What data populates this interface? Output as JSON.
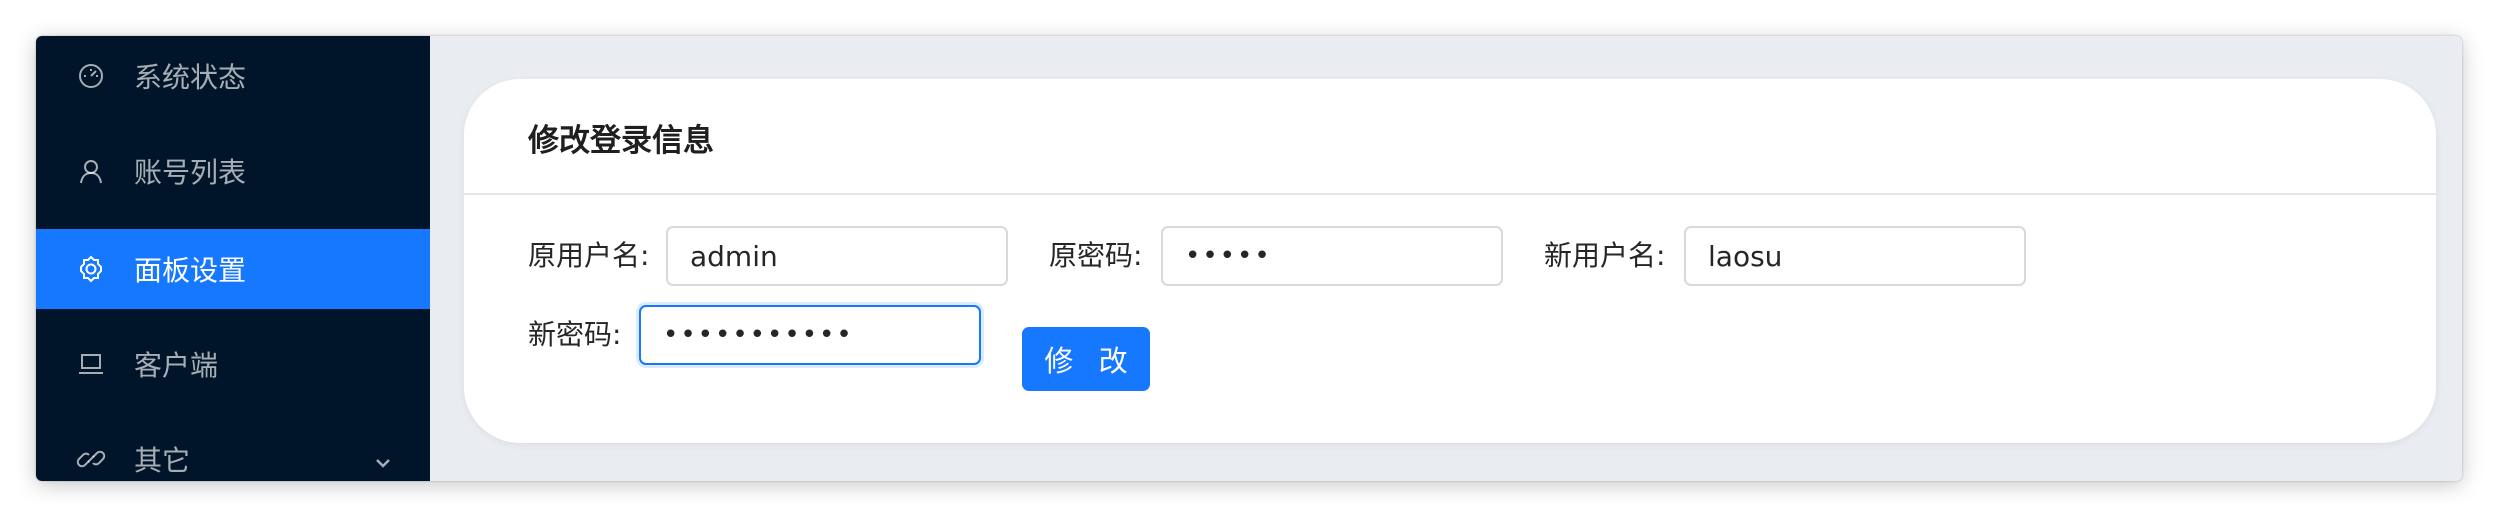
{
  "sidebar": {
    "items": [
      {
        "label": "系统状态",
        "icon": "dashboard-icon",
        "active": false
      },
      {
        "label": "账号列表",
        "icon": "user-icon",
        "active": false
      },
      {
        "label": "面板设置",
        "icon": "gear-icon",
        "active": true
      },
      {
        "label": "客户端",
        "icon": "laptop-icon",
        "active": false
      },
      {
        "label": "其它",
        "icon": "link-icon",
        "active": false,
        "has_submenu": true
      }
    ]
  },
  "card": {
    "title": "修改登录信息"
  },
  "form": {
    "old_username_label": "原用户名:",
    "old_username_value": "admin",
    "old_password_label": "原密码:",
    "old_password_value": "•••••",
    "new_username_label": "新用户名:",
    "new_username_value": "laosu",
    "new_password_label": "新密码:",
    "new_password_value": "•••••••••••",
    "submit_label": "修 改"
  },
  "colors": {
    "sidebar_bg": "#001529",
    "accent": "#1677ff",
    "content_bg": "#e9ecf1"
  }
}
